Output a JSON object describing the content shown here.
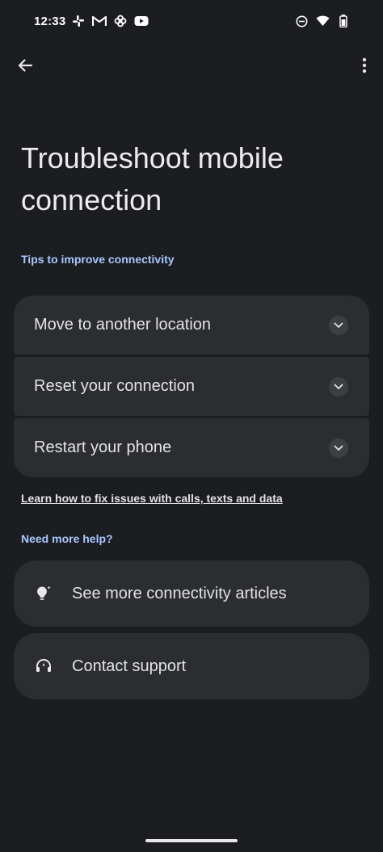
{
  "status_bar": {
    "time": "12:33",
    "left_icons": [
      "slack-icon",
      "gmail-icon",
      "pinwheel-icon",
      "youtube-icon"
    ],
    "right_icons": [
      "dnd-icon",
      "wifi-icon",
      "battery-icon"
    ]
  },
  "top_bar": {
    "back_icon": "arrow-left-icon",
    "more_icon": "more-vert-icon"
  },
  "page": {
    "title_line1": "Troubleshoot mobile",
    "title_line2": "connection"
  },
  "tips": {
    "label": "Tips to improve connectivity",
    "items": [
      {
        "label": "Move to another location",
        "icon": "chevron-down-icon"
      },
      {
        "label": "Reset your connection",
        "icon": "chevron-down-icon"
      },
      {
        "label": "Restart your phone",
        "icon": "chevron-down-icon"
      }
    ]
  },
  "learn_link": "Learn how to fix issues with calls, texts and data",
  "help": {
    "label": "Need more help?",
    "cards": [
      {
        "label": "See more connectivity articles",
        "icon": "lightbulb-icon"
      },
      {
        "label": "Contact support",
        "icon": "headset-icon"
      }
    ]
  },
  "colors": {
    "background": "#1b1d21",
    "surface": "#2b2d31",
    "accent_text": "#a9c7ff",
    "primary_text": "#e3e3e6"
  }
}
